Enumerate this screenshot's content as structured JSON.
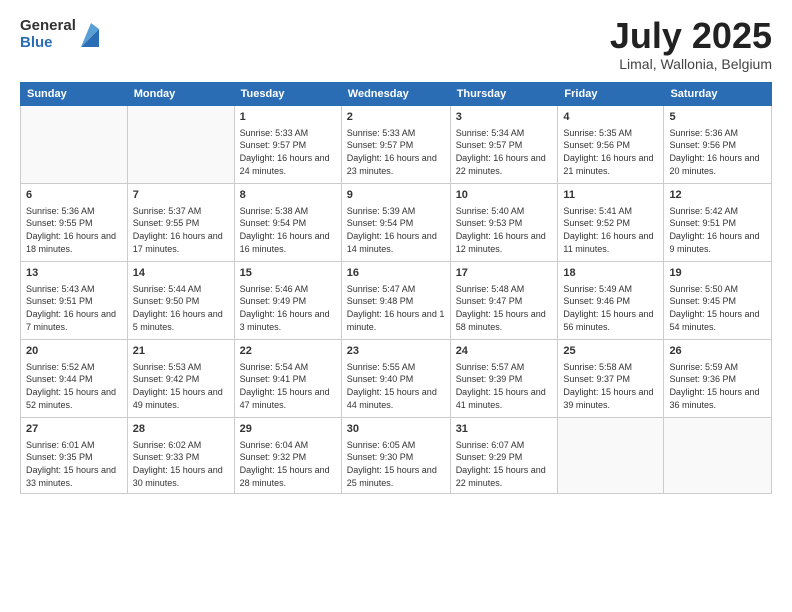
{
  "logo": {
    "general": "General",
    "blue": "Blue"
  },
  "title": "July 2025",
  "subtitle": "Limal, Wallonia, Belgium",
  "days_of_week": [
    "Sunday",
    "Monday",
    "Tuesday",
    "Wednesday",
    "Thursday",
    "Friday",
    "Saturday"
  ],
  "weeks": [
    [
      {
        "day": "",
        "info": ""
      },
      {
        "day": "",
        "info": ""
      },
      {
        "day": "1",
        "info": "Sunrise: 5:33 AM\nSunset: 9:57 PM\nDaylight: 16 hours and 24 minutes."
      },
      {
        "day": "2",
        "info": "Sunrise: 5:33 AM\nSunset: 9:57 PM\nDaylight: 16 hours and 23 minutes."
      },
      {
        "day": "3",
        "info": "Sunrise: 5:34 AM\nSunset: 9:57 PM\nDaylight: 16 hours and 22 minutes."
      },
      {
        "day": "4",
        "info": "Sunrise: 5:35 AM\nSunset: 9:56 PM\nDaylight: 16 hours and 21 minutes."
      },
      {
        "day": "5",
        "info": "Sunrise: 5:36 AM\nSunset: 9:56 PM\nDaylight: 16 hours and 20 minutes."
      }
    ],
    [
      {
        "day": "6",
        "info": "Sunrise: 5:36 AM\nSunset: 9:55 PM\nDaylight: 16 hours and 18 minutes."
      },
      {
        "day": "7",
        "info": "Sunrise: 5:37 AM\nSunset: 9:55 PM\nDaylight: 16 hours and 17 minutes."
      },
      {
        "day": "8",
        "info": "Sunrise: 5:38 AM\nSunset: 9:54 PM\nDaylight: 16 hours and 16 minutes."
      },
      {
        "day": "9",
        "info": "Sunrise: 5:39 AM\nSunset: 9:54 PM\nDaylight: 16 hours and 14 minutes."
      },
      {
        "day": "10",
        "info": "Sunrise: 5:40 AM\nSunset: 9:53 PM\nDaylight: 16 hours and 12 minutes."
      },
      {
        "day": "11",
        "info": "Sunrise: 5:41 AM\nSunset: 9:52 PM\nDaylight: 16 hours and 11 minutes."
      },
      {
        "day": "12",
        "info": "Sunrise: 5:42 AM\nSunset: 9:51 PM\nDaylight: 16 hours and 9 minutes."
      }
    ],
    [
      {
        "day": "13",
        "info": "Sunrise: 5:43 AM\nSunset: 9:51 PM\nDaylight: 16 hours and 7 minutes."
      },
      {
        "day": "14",
        "info": "Sunrise: 5:44 AM\nSunset: 9:50 PM\nDaylight: 16 hours and 5 minutes."
      },
      {
        "day": "15",
        "info": "Sunrise: 5:46 AM\nSunset: 9:49 PM\nDaylight: 16 hours and 3 minutes."
      },
      {
        "day": "16",
        "info": "Sunrise: 5:47 AM\nSunset: 9:48 PM\nDaylight: 16 hours and 1 minute."
      },
      {
        "day": "17",
        "info": "Sunrise: 5:48 AM\nSunset: 9:47 PM\nDaylight: 15 hours and 58 minutes."
      },
      {
        "day": "18",
        "info": "Sunrise: 5:49 AM\nSunset: 9:46 PM\nDaylight: 15 hours and 56 minutes."
      },
      {
        "day": "19",
        "info": "Sunrise: 5:50 AM\nSunset: 9:45 PM\nDaylight: 15 hours and 54 minutes."
      }
    ],
    [
      {
        "day": "20",
        "info": "Sunrise: 5:52 AM\nSunset: 9:44 PM\nDaylight: 15 hours and 52 minutes."
      },
      {
        "day": "21",
        "info": "Sunrise: 5:53 AM\nSunset: 9:42 PM\nDaylight: 15 hours and 49 minutes."
      },
      {
        "day": "22",
        "info": "Sunrise: 5:54 AM\nSunset: 9:41 PM\nDaylight: 15 hours and 47 minutes."
      },
      {
        "day": "23",
        "info": "Sunrise: 5:55 AM\nSunset: 9:40 PM\nDaylight: 15 hours and 44 minutes."
      },
      {
        "day": "24",
        "info": "Sunrise: 5:57 AM\nSunset: 9:39 PM\nDaylight: 15 hours and 41 minutes."
      },
      {
        "day": "25",
        "info": "Sunrise: 5:58 AM\nSunset: 9:37 PM\nDaylight: 15 hours and 39 minutes."
      },
      {
        "day": "26",
        "info": "Sunrise: 5:59 AM\nSunset: 9:36 PM\nDaylight: 15 hours and 36 minutes."
      }
    ],
    [
      {
        "day": "27",
        "info": "Sunrise: 6:01 AM\nSunset: 9:35 PM\nDaylight: 15 hours and 33 minutes."
      },
      {
        "day": "28",
        "info": "Sunrise: 6:02 AM\nSunset: 9:33 PM\nDaylight: 15 hours and 30 minutes."
      },
      {
        "day": "29",
        "info": "Sunrise: 6:04 AM\nSunset: 9:32 PM\nDaylight: 15 hours and 28 minutes."
      },
      {
        "day": "30",
        "info": "Sunrise: 6:05 AM\nSunset: 9:30 PM\nDaylight: 15 hours and 25 minutes."
      },
      {
        "day": "31",
        "info": "Sunrise: 6:07 AM\nSunset: 9:29 PM\nDaylight: 15 hours and 22 minutes."
      },
      {
        "day": "",
        "info": ""
      },
      {
        "day": "",
        "info": ""
      }
    ]
  ]
}
